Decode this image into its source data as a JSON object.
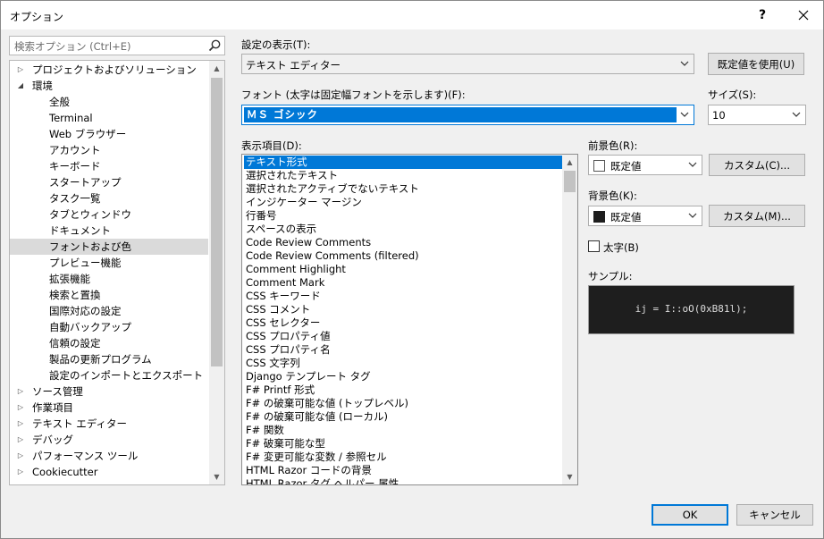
{
  "window": {
    "title": "オプション",
    "help_label": "?",
    "close_label": "✕"
  },
  "search": {
    "placeholder": "検索オプション (Ctrl+E)"
  },
  "tree": {
    "items": [
      {
        "label": "プロジェクトおよびソリューション",
        "arrow": "▷",
        "level": 0
      },
      {
        "label": "環境",
        "arrow": "◢",
        "level": 0
      },
      {
        "label": "全般",
        "arrow": "",
        "level": 1
      },
      {
        "label": "Terminal",
        "arrow": "",
        "level": 1
      },
      {
        "label": "Web ブラウザー",
        "arrow": "",
        "level": 1
      },
      {
        "label": "アカウント",
        "arrow": "",
        "level": 1
      },
      {
        "label": "キーボード",
        "arrow": "",
        "level": 1
      },
      {
        "label": "スタートアップ",
        "arrow": "",
        "level": 1
      },
      {
        "label": "タスク一覧",
        "arrow": "",
        "level": 1
      },
      {
        "label": "タブとウィンドウ",
        "arrow": "",
        "level": 1
      },
      {
        "label": "ドキュメント",
        "arrow": "",
        "level": 1
      },
      {
        "label": "フォントおよび色",
        "arrow": "",
        "level": 1,
        "selected": true
      },
      {
        "label": "プレビュー機能",
        "arrow": "",
        "level": 1
      },
      {
        "label": "拡張機能",
        "arrow": "",
        "level": 1
      },
      {
        "label": "検索と置換",
        "arrow": "",
        "level": 1
      },
      {
        "label": "国際対応の設定",
        "arrow": "",
        "level": 1
      },
      {
        "label": "自動バックアップ",
        "arrow": "",
        "level": 1
      },
      {
        "label": "信頼の設定",
        "arrow": "",
        "level": 1
      },
      {
        "label": "製品の更新プログラム",
        "arrow": "",
        "level": 1
      },
      {
        "label": "設定のインポートとエクスポート",
        "arrow": "",
        "level": 1
      },
      {
        "label": "ソース管理",
        "arrow": "▷",
        "level": 0
      },
      {
        "label": "作業項目",
        "arrow": "▷",
        "level": 0
      },
      {
        "label": "テキスト エディター",
        "arrow": "▷",
        "level": 0
      },
      {
        "label": "デバッグ",
        "arrow": "▷",
        "level": 0
      },
      {
        "label": "パフォーマンス ツール",
        "arrow": "▷",
        "level": 0
      },
      {
        "label": "Cookiecutter",
        "arrow": "▷",
        "level": 0
      }
    ]
  },
  "settings": {
    "show_settings_label": "設定の表示(T):",
    "show_settings_value": "テキスト エディター",
    "use_defaults_button": "既定値を使用(U)",
    "font_label": "フォント (太字は固定幅フォントを示します)(F):",
    "font_value": "ＭＳ ゴシック",
    "size_label": "サイズ(S):",
    "size_value": "10",
    "display_items_label": "表示項目(D):",
    "display_items": [
      "テキスト形式",
      "選択されたテキスト",
      "選択されたアクティブでないテキスト",
      "インジケーター マージン",
      "行番号",
      "スペースの表示",
      "Code Review Comments",
      "Code Review Comments (filtered)",
      "Comment Highlight",
      "Comment Mark",
      "CSS キーワード",
      "CSS コメント",
      "CSS セレクター",
      "CSS プロパティ値",
      "CSS プロパティ名",
      "CSS 文字列",
      "Django テンプレート タグ",
      "F# Printf 形式",
      "F# の破棄可能な値 (トップレベル)",
      "F# の破棄可能な値 (ローカル)",
      "F# 関数",
      "F# 破棄可能な型",
      "F# 変更可能な変数 / 参照セル",
      "HTML Razor コードの背景",
      "HTML Razor タグ ヘルパー 属性"
    ],
    "foreground_label": "前景色(R):",
    "foreground_value": "既定値",
    "foreground_custom": "カスタム(C)...",
    "background_label": "背景色(K):",
    "background_value": "既定値",
    "background_custom": "カスタム(M)...",
    "bold_label": "太字(B)",
    "sample_label": "サンプル:",
    "sample_text": "ij = I::oO(0xB81l);"
  },
  "footer": {
    "ok": "OK",
    "cancel": "キャンセル"
  },
  "colors": {
    "accent": "#0078d7",
    "foreground_swatch": "#ffffff",
    "background_swatch": "#1e1e1e",
    "sample_bg": "#1e1e1e",
    "tree_selected": "#dadada"
  }
}
